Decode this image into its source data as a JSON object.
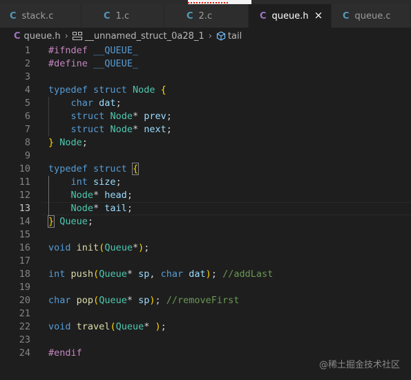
{
  "tabs": [
    {
      "icon": "C",
      "label": "stack.c",
      "active": false
    },
    {
      "icon": "C",
      "label": "1.c",
      "active": false
    },
    {
      "icon": "C",
      "label": "2.c",
      "active": false
    },
    {
      "icon": "C",
      "label": "queue.h",
      "active": true
    },
    {
      "icon": "C",
      "label": "queue.c",
      "active": false
    }
  ],
  "tab_close_glyph": "×",
  "breadcrumb": {
    "file_icon": "C",
    "file": "queue.h",
    "separator": "›",
    "struct_icon": "struct-icon",
    "struct": "__unnamed_struct_0a28_1",
    "field_icon": "field-icon",
    "field": "tail"
  },
  "editor": {
    "current_line": 13,
    "lines": [
      {
        "n": "1",
        "tokens": [
          [
            "pre",
            "#ifndef"
          ],
          [
            "p",
            " "
          ],
          [
            "mac",
            "__QUEUE_"
          ]
        ]
      },
      {
        "n": "2",
        "tokens": [
          [
            "pre",
            "#define"
          ],
          [
            "p",
            " "
          ],
          [
            "mac",
            "__QUEUE_"
          ]
        ]
      },
      {
        "n": "3",
        "tokens": []
      },
      {
        "n": "4",
        "tokens": [
          [
            "kw",
            "typedef"
          ],
          [
            "p",
            " "
          ],
          [
            "kw",
            "struct"
          ],
          [
            "p",
            " "
          ],
          [
            "type",
            "Node"
          ],
          [
            "p",
            " "
          ],
          [
            "b1",
            "{"
          ]
        ]
      },
      {
        "n": "5",
        "tokens": [
          [
            "p",
            "    "
          ],
          [
            "kw",
            "char"
          ],
          [
            "p",
            " "
          ],
          [
            "var",
            "dat"
          ],
          [
            "p",
            ";"
          ]
        ]
      },
      {
        "n": "6",
        "tokens": [
          [
            "p",
            "    "
          ],
          [
            "kw",
            "struct"
          ],
          [
            "p",
            " "
          ],
          [
            "type",
            "Node"
          ],
          [
            "p",
            "* "
          ],
          [
            "var",
            "prev"
          ],
          [
            "p",
            ";"
          ]
        ]
      },
      {
        "n": "7",
        "tokens": [
          [
            "p",
            "    "
          ],
          [
            "kw",
            "struct"
          ],
          [
            "p",
            " "
          ],
          [
            "type",
            "Node"
          ],
          [
            "p",
            "* "
          ],
          [
            "var",
            "next"
          ],
          [
            "p",
            ";"
          ]
        ]
      },
      {
        "n": "8",
        "tokens": [
          [
            "b1",
            "}"
          ],
          [
            "p",
            " "
          ],
          [
            "type",
            "Node"
          ],
          [
            "p",
            ";"
          ]
        ]
      },
      {
        "n": "9",
        "tokens": []
      },
      {
        "n": "10",
        "tokens": [
          [
            "kw",
            "typedef"
          ],
          [
            "p",
            " "
          ],
          [
            "kw",
            "struct"
          ],
          [
            "p",
            " "
          ],
          [
            "b1m",
            "{"
          ]
        ]
      },
      {
        "n": "11",
        "tokens": [
          [
            "p",
            "    "
          ],
          [
            "kw",
            "int"
          ],
          [
            "p",
            " "
          ],
          [
            "var",
            "size"
          ],
          [
            "p",
            ";"
          ]
        ]
      },
      {
        "n": "12",
        "tokens": [
          [
            "p",
            "    "
          ],
          [
            "type",
            "Node"
          ],
          [
            "p",
            "* "
          ],
          [
            "var",
            "head"
          ],
          [
            "p",
            ";"
          ]
        ]
      },
      {
        "n": "13",
        "tokens": [
          [
            "p",
            "    "
          ],
          [
            "type",
            "Node"
          ],
          [
            "p",
            "* "
          ],
          [
            "var",
            "tail"
          ],
          [
            "p",
            ";"
          ]
        ]
      },
      {
        "n": "14",
        "tokens": [
          [
            "b1m",
            "}"
          ],
          [
            "p",
            " "
          ],
          [
            "type",
            "Queue"
          ],
          [
            "p",
            ";"
          ]
        ]
      },
      {
        "n": "15",
        "tokens": []
      },
      {
        "n": "16",
        "tokens": [
          [
            "kw",
            "void"
          ],
          [
            "p",
            " "
          ],
          [
            "fn",
            "init"
          ],
          [
            "b1",
            "("
          ],
          [
            "type",
            "Queue"
          ],
          [
            "p",
            "*"
          ],
          [
            "b1",
            ")"
          ],
          [
            "p",
            ";"
          ]
        ]
      },
      {
        "n": "17",
        "tokens": []
      },
      {
        "n": "18",
        "tokens": [
          [
            "kw",
            "int"
          ],
          [
            "p",
            " "
          ],
          [
            "fn",
            "push"
          ],
          [
            "b1",
            "("
          ],
          [
            "type",
            "Queue"
          ],
          [
            "p",
            "* "
          ],
          [
            "var",
            "sp"
          ],
          [
            "p",
            ", "
          ],
          [
            "kw",
            "char"
          ],
          [
            "p",
            " "
          ],
          [
            "var",
            "dat"
          ],
          [
            "b1",
            ")"
          ],
          [
            "p",
            "; "
          ],
          [
            "com",
            "//addLast"
          ]
        ]
      },
      {
        "n": "19",
        "tokens": []
      },
      {
        "n": "20",
        "tokens": [
          [
            "kw",
            "char"
          ],
          [
            "p",
            " "
          ],
          [
            "fn",
            "pop"
          ],
          [
            "b1",
            "("
          ],
          [
            "type",
            "Queue"
          ],
          [
            "p",
            "* "
          ],
          [
            "var",
            "sp"
          ],
          [
            "b1",
            ")"
          ],
          [
            "p",
            "; "
          ],
          [
            "com",
            "//removeFirst"
          ]
        ]
      },
      {
        "n": "21",
        "tokens": []
      },
      {
        "n": "22",
        "tokens": [
          [
            "kw",
            "void"
          ],
          [
            "p",
            " "
          ],
          [
            "fn",
            "travel"
          ],
          [
            "b1",
            "("
          ],
          [
            "type",
            "Queue"
          ],
          [
            "p",
            "* "
          ],
          [
            "b1",
            ")"
          ],
          [
            "p",
            ";"
          ]
        ]
      },
      {
        "n": "23",
        "tokens": []
      },
      {
        "n": "24",
        "tokens": [
          [
            "pre",
            "#endif"
          ]
        ]
      }
    ]
  },
  "watermark": "@稀土掘金技术社区"
}
